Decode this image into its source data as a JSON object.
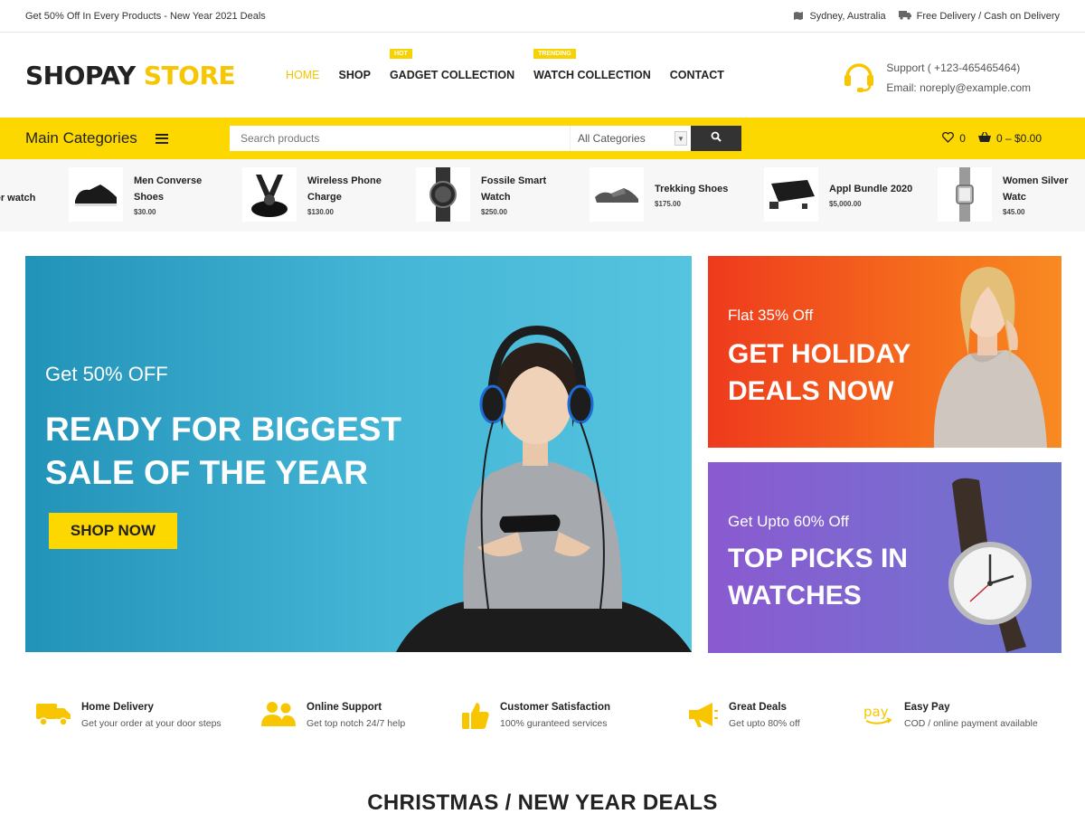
{
  "topbar": {
    "promo": "Get 50% Off In Every Products - New Year 2021 Deals",
    "location": "Sydney, Australia",
    "delivery": "Free Delivery / Cash on Delivery",
    "location_icon": "map-icon",
    "delivery_icon": "truck-icon"
  },
  "header": {
    "logo_part1": "SHOPAY",
    "logo_part2": "STORE",
    "nav": [
      {
        "label": "HOME",
        "badge": ""
      },
      {
        "label": "SHOP",
        "badge": ""
      },
      {
        "label": "GADGET COLLECTION",
        "badge": "HOT"
      },
      {
        "label": "WATCH COLLECTION",
        "badge": "TRENDING"
      },
      {
        "label": "CONTACT",
        "badge": ""
      }
    ],
    "support_line1": "Support ( +123-465465464)",
    "support_line2": "Email: noreply@example.com",
    "accent": "#f7c600"
  },
  "categorybar": {
    "title": "Main Categories",
    "search_placeholder": "Search products",
    "category_select": "All Categories",
    "wishlist_count": "0",
    "cart_summary": "0 – $0.00",
    "bar_color": "#fdd800"
  },
  "product_strip": [
    {
      "name": "her watch",
      "price": ""
    },
    {
      "name": "Men Converse Shoes",
      "price": "$30.00"
    },
    {
      "name": "Wireless Phone Charge",
      "price": "$130.00"
    },
    {
      "name": "Fossile Smart Watch",
      "price": "$250.00"
    },
    {
      "name": "Trekking Shoes",
      "price": "$175.00"
    },
    {
      "name": "Appl Bundle 2020",
      "price": "$5,000.00"
    },
    {
      "name": "Women Silver Watc",
      "price": "$45.00"
    }
  ],
  "hero": {
    "main": {
      "kicker": "Get 50% OFF",
      "headline": "READY FOR BIGGEST SALE OF THE YEAR",
      "button": "SHOP NOW"
    },
    "side_top": {
      "kicker": "Flat 35% Off",
      "headline": "GET HOLIDAY DEALS NOW"
    },
    "side_bottom": {
      "kicker": "Get Upto 60% Off",
      "headline": "TOP PICKS IN WATCHES"
    }
  },
  "features": [
    {
      "title": "Home Delivery",
      "subtitle": "Get your order at your door steps",
      "icon": "truck-icon"
    },
    {
      "title": "Online Support",
      "subtitle": "Get top notch 24/7 help",
      "icon": "users-icon"
    },
    {
      "title": "Customer Satisfaction",
      "subtitle": "100% guranteed services",
      "icon": "thumbs-up-icon"
    },
    {
      "title": "Great Deals",
      "subtitle": "Get upto 80% off",
      "icon": "megaphone-icon"
    },
    {
      "title": "Easy Pay",
      "subtitle": "COD / online payment available",
      "icon": "pay-icon"
    }
  ],
  "section": {
    "title": "CHRISTMAS / NEW YEAR DEALS"
  }
}
